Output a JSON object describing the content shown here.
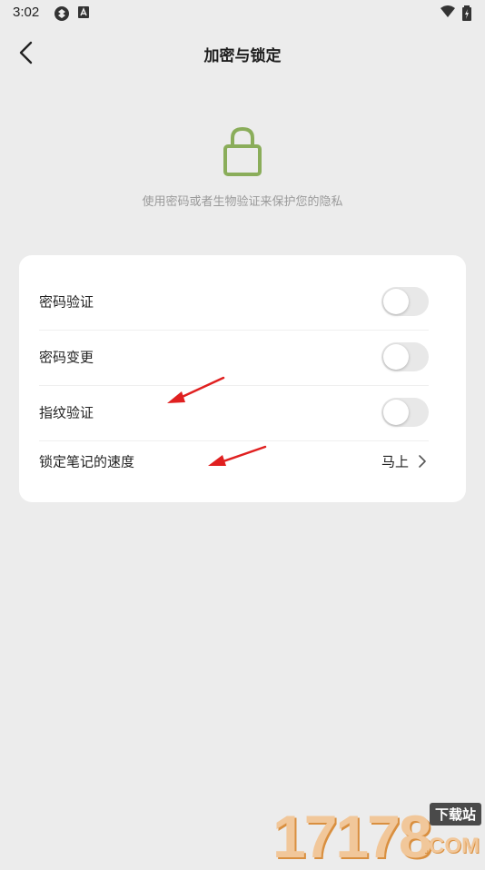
{
  "status_bar": {
    "time": "3:02"
  },
  "header": {
    "title": "加密与锁定",
    "back_icon": "chevron-left-icon"
  },
  "hero": {
    "icon": "lock-icon",
    "icon_color": "#8aad5a",
    "description": "使用密码或者生物验证来保护您的隐私"
  },
  "settings": {
    "items": [
      {
        "label": "密码验证",
        "type": "toggle",
        "enabled": false
      },
      {
        "label": "密码变更",
        "type": "toggle",
        "enabled": false
      },
      {
        "label": "指纹验证",
        "type": "toggle",
        "enabled": false
      },
      {
        "label": "锁定笔记的速度",
        "type": "select",
        "value": "马上"
      }
    ]
  },
  "annotations": {
    "arrow_color": "#e02020"
  },
  "watermark": {
    "digits": "17178",
    "badge": "下载站",
    "suffix": ".COM"
  }
}
